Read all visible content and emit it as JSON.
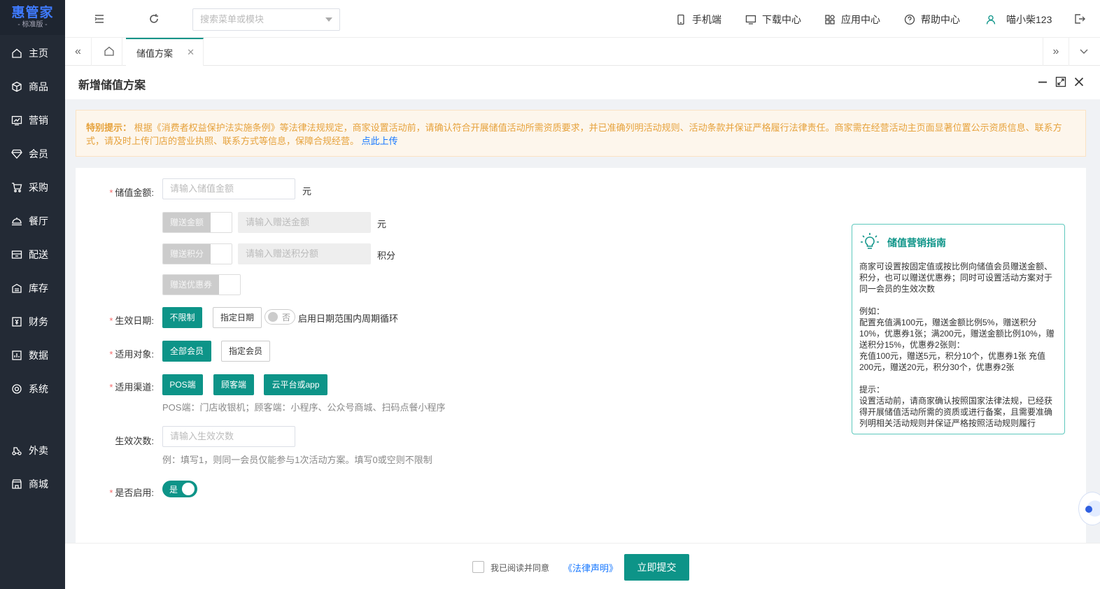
{
  "brand": {
    "name": "惠管家",
    "edition": "- 标准版 -"
  },
  "sidebar": {
    "items": [
      {
        "label": "主页",
        "icon": "home-icon"
      },
      {
        "label": "商品",
        "icon": "box-icon"
      },
      {
        "label": "营销",
        "icon": "chart-icon"
      },
      {
        "label": "会员",
        "icon": "diamond-icon"
      },
      {
        "label": "采购",
        "icon": "cart-icon"
      },
      {
        "label": "餐厅",
        "icon": "dish-icon"
      },
      {
        "label": "配送",
        "icon": "delivery-icon"
      },
      {
        "label": "库存",
        "icon": "warehouse-icon"
      },
      {
        "label": "财务",
        "icon": "finance-icon"
      },
      {
        "label": "数据",
        "icon": "data-icon"
      },
      {
        "label": "系统",
        "icon": "system-icon"
      }
    ],
    "extra_items": [
      {
        "label": "外卖",
        "icon": "takeout-icon"
      },
      {
        "label": "商城",
        "icon": "mall-icon"
      }
    ]
  },
  "header": {
    "search_placeholder": "搜索菜单或模块",
    "mobile": "手机端",
    "download": "下载中心",
    "apps": "应用中心",
    "help": "帮助中心",
    "user": "喵小柴123"
  },
  "tabs": {
    "active": "储值方案"
  },
  "panel": {
    "title": "新增储值方案"
  },
  "notice": {
    "label": "特别提示：",
    "text": "根据《消费者权益保护法实施条例》等法律法规规定，商家设置活动前，请确认符合开展储值活动所需资质要求，并已准确列明活动规则、活动条款并保证严格履行法律责任。商家需在经营活动主页面显著位置公示资质信息、联系方式，请及时上传门店的营业执照、联系方式等信息，保障合规经营。",
    "link": "点此上传"
  },
  "form": {
    "amount_label": "储值金额:",
    "amount_placeholder": "请输入储值金额",
    "unit_yuan": "元",
    "gift_amount_label": "赠送金额",
    "gift_amount_placeholder": "请输入赠送金额",
    "gift_points_label": "赠送积分",
    "gift_points_placeholder": "请输入赠送积分额",
    "unit_points": "积分",
    "gift_coupon_label": "赠送优惠券",
    "date_label": "生效日期:",
    "date_unlimited": "不限制",
    "date_specified": "指定日期",
    "cycle_switch": "否",
    "cycle_text": "启用日期范围内周期循环",
    "target_label": "适用对象:",
    "target_all": "全部会员",
    "target_specified": "指定会员",
    "channel_label": "适用渠道:",
    "channel_pos": "POS端",
    "channel_customer": "顾客端",
    "channel_cloud": "云平台或app",
    "channel_hint": "POS端：门店收银机；顾客端：小程序、公众号商城、扫码点餐小程序",
    "times_label": "生效次数:",
    "times_placeholder": "请输入生效次数",
    "times_hint": "例：填写1，则同一会员仅能参与1次活动方案。填写0或空则不限制",
    "enabled_label": "是否启用:",
    "enabled_value": "是"
  },
  "guide": {
    "title": "储值营销指南",
    "p1": "商家可设置按固定值或按比例向储值会员赠送金额、积分，也可以赠送优惠券；同时可设置活动方案对于同一会员的生效次数",
    "ex_title": "例如：",
    "ex_text": "配置充值满100元，赠送金额比例5%，赠送积分10%，优惠券1张；满200元，赠送金额比例10%，赠送积分15%，优惠券2张则：",
    "ex_result": "充值100元，赠送5元，积分10个，优惠券1张 充值200元，赠送20元，积分30个，优惠券2张",
    "tip_title": "提示：",
    "tip_text": "设置活动前，请商家确认按照国家法律法规，已经获得开展储值活动所需的资质或进行备案，且需要准确列明相关活动规则并保证严格按照活动规则履行"
  },
  "footer": {
    "agree": "我已阅读并同意",
    "law": "《法律声明》",
    "submit": "立即提交"
  },
  "colors": {
    "primary": "#0d9488",
    "sidebar": "#232a35",
    "notice": "#e6a23c",
    "link": "#1677ff"
  }
}
